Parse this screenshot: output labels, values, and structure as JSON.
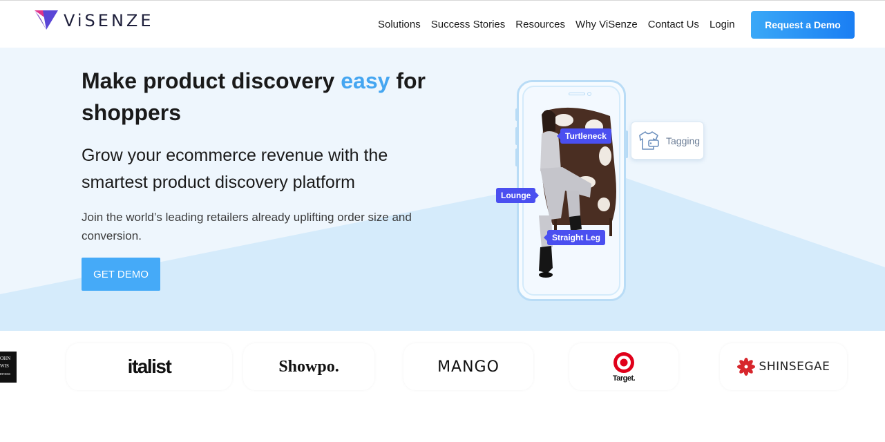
{
  "header": {
    "logo_text": "ViSENZE",
    "nav": [
      "Solutions",
      "Success Stories",
      "Resources",
      "Why ViSenze",
      "Contact Us",
      "Login"
    ],
    "cta": "Request a Demo"
  },
  "hero": {
    "headline_part1": "Make product discovery ",
    "headline_accent": "easy",
    "headline_part2": " for shoppers",
    "subhead": "Grow your ecommerce revenue with the smartest product discovery platform",
    "body": "Join the world’s leading retailers already uplifting order size and conversion.",
    "cta": "GET DEMO",
    "phone_tags": {
      "turtleneck": "Turtleneck",
      "lounge": "Lounge",
      "straight_leg": "Straight Leg"
    },
    "feature_card": "Tagging"
  },
  "brands": {
    "john_lewis_lines": [
      "OHN",
      "WIS",
      "RTNERS"
    ],
    "italist": "italist",
    "showpo": "Showpo.",
    "mango": "MANGO",
    "target": "Target.",
    "shinsegae": "SHINSEGAE"
  },
  "colors": {
    "accent": "#45a6f1",
    "cta_gradient_start": "#3aa8f7",
    "cta_gradient_end": "#1a7ef3",
    "tag": "#4a4ff0",
    "hero_bg": "#eef6fd"
  }
}
